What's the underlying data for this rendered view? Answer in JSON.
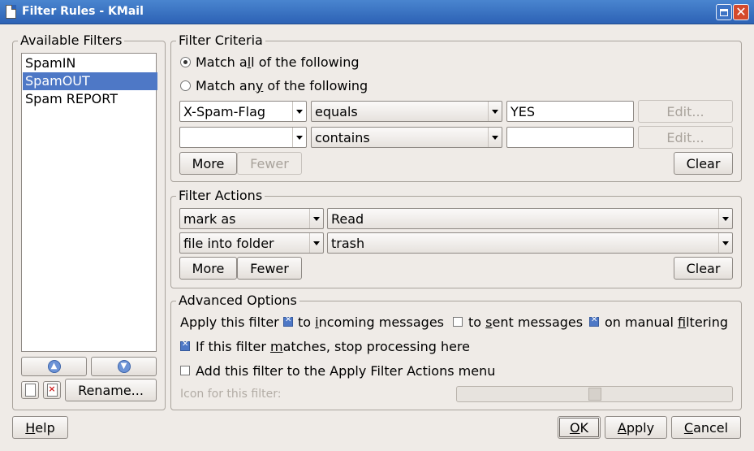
{
  "window": {
    "title": "Filter Rules - KMail"
  },
  "available_filters": {
    "legend": "Available Filters",
    "items": [
      {
        "label": "SpamIN",
        "selected": false
      },
      {
        "label": "SpamOUT",
        "selected": true
      },
      {
        "label": "Spam REPORT",
        "selected": false
      }
    ],
    "rename_label": "Rename..."
  },
  "criteria": {
    "legend": "Filter Criteria",
    "match_all": {
      "pre": "Match a",
      "key": "l",
      "post": "l of the following",
      "checked": true
    },
    "match_any": {
      "pre": "Match an",
      "key": "y",
      "post": " of the following",
      "checked": false
    },
    "rules": [
      {
        "field": "X-Spam-Flag",
        "op": "equals",
        "value": "YES",
        "edit_label": "Edit..."
      },
      {
        "field": "",
        "op": "contains",
        "value": "",
        "edit_label": "Edit..."
      }
    ],
    "more_label": "More",
    "fewer_label": "Fewer",
    "clear_label": "Clear"
  },
  "actions": {
    "legend": "Filter Actions",
    "rules": [
      {
        "action": "mark as",
        "value": "Read"
      },
      {
        "action": "file into folder",
        "value": "trash"
      }
    ],
    "more_label": "More",
    "fewer_label": "Fewer",
    "clear_label": "Clear"
  },
  "advanced": {
    "legend": "Advanced Options",
    "apply_label": "Apply this filter",
    "incoming": {
      "pre": "to ",
      "key": "i",
      "post": "ncoming messages",
      "checked": true
    },
    "sent": {
      "pre": "to ",
      "key": "s",
      "post": "ent messages",
      "checked": false
    },
    "manual": {
      "pre": "on manual ",
      "key": "f",
      "post": "iltering",
      "checked": true
    },
    "stop": {
      "pre": "If this filter ",
      "key": "m",
      "post": "atches, stop processing here",
      "checked": true
    },
    "menu": {
      "label": "Add this filter to the Apply Filter Actions menu",
      "checked": false
    },
    "icon_label": "Icon for this filter:"
  },
  "footer": {
    "help": {
      "key": "H",
      "post": "elp"
    },
    "ok": {
      "key": "O",
      "post": "K"
    },
    "apply": {
      "key": "A",
      "post": "pply"
    },
    "cancel": {
      "key": "C",
      "post": "ancel"
    }
  }
}
